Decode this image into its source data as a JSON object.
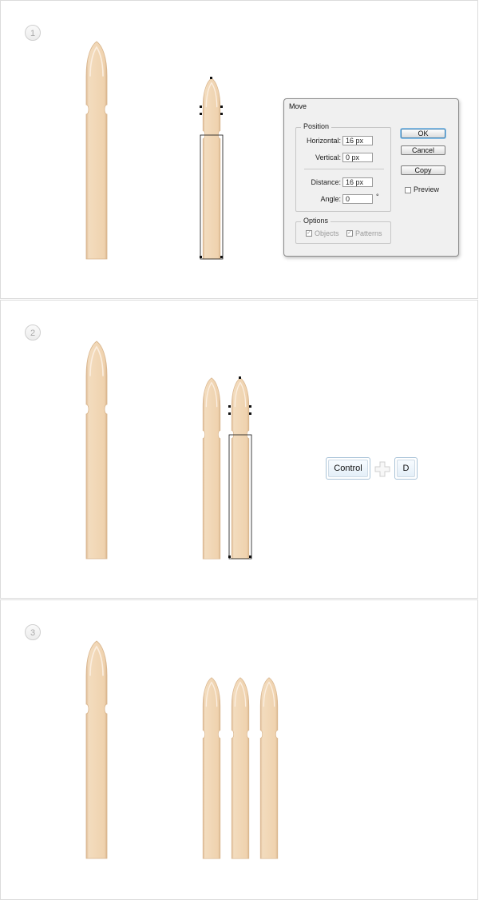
{
  "steps": [
    {
      "number": "1"
    },
    {
      "number": "2"
    },
    {
      "number": "3"
    }
  ],
  "colors": {
    "picket_fill": "#f1d7b6",
    "picket_edge": "#dcb994",
    "picket_highlight": "#fbeee0",
    "selection": "#111111",
    "panel_border": "#dcdcdc",
    "key_border": "#a9c3d8"
  },
  "move_dialog": {
    "title": "Move",
    "position_legend": "Position",
    "horizontal_label": "Horizontal:",
    "horizontal_value": "16 px",
    "vertical_label": "Vertical:",
    "vertical_value": "0 px",
    "distance_label": "Distance:",
    "distance_value": "16 px",
    "angle_label": "Angle:",
    "angle_value": "0",
    "angle_unit": "°",
    "options_legend": "Options",
    "objects_label": "Objects",
    "patterns_label": "Patterns",
    "ok_label": "OK",
    "cancel_label": "Cancel",
    "copy_label": "Copy",
    "preview_label": "Preview",
    "objects_checked": true,
    "patterns_checked": true,
    "preview_checked": false
  },
  "shortcut": {
    "modifier": "Control",
    "key": "D"
  }
}
